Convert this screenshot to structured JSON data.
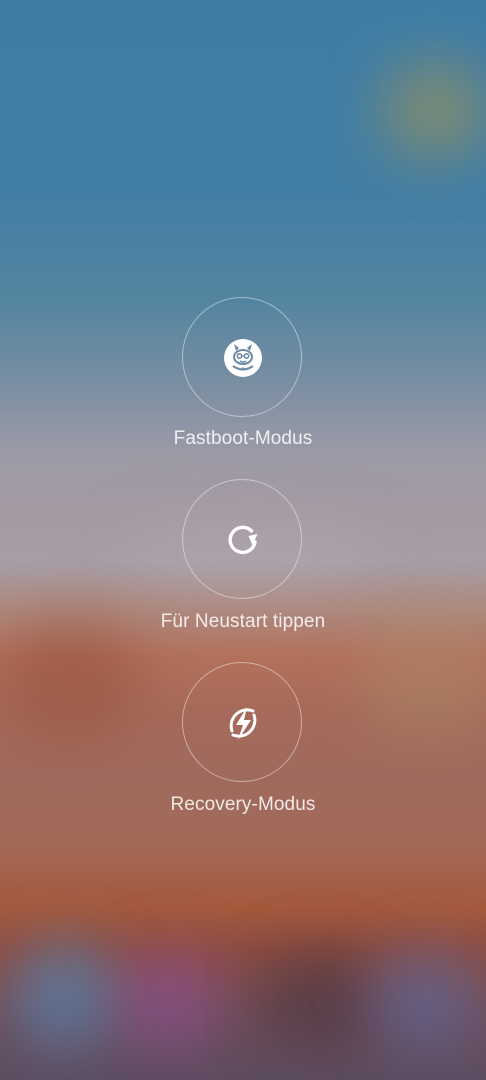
{
  "power_menu": {
    "items": [
      {
        "label": "Fastboot-Modus",
        "icon": "mi-bunny-icon"
      },
      {
        "label": "Für Neustart tippen",
        "icon": "restart-icon"
      },
      {
        "label": "Recovery-Modus",
        "icon": "lightning-icon"
      }
    ]
  },
  "colors": {
    "icon": "#ffffff",
    "ring_border": "rgba(255,255,255,0.45)",
    "label": "rgba(255,255,255,0.85)"
  }
}
